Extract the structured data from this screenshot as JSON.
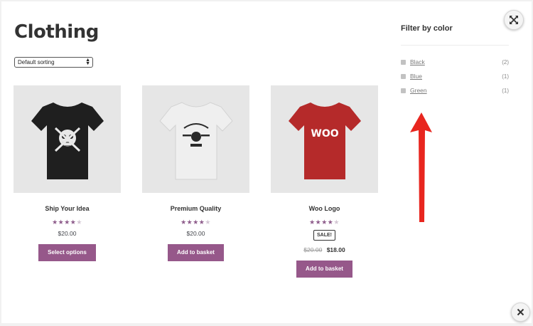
{
  "page": {
    "title": "Clothing"
  },
  "sorting": {
    "selected": "Default sorting"
  },
  "products": [
    {
      "name": "Ship Your Idea",
      "rating": 4.5,
      "price": "$20.00",
      "button": "Select options",
      "shirt_color": "#1f1f1f"
    },
    {
      "name": "Premium Quality",
      "rating": 4.5,
      "price": "$20.00",
      "button": "Add to basket",
      "shirt_color": "#efefef"
    },
    {
      "name": "Woo Logo",
      "rating": 4,
      "sale_badge": "SALE!",
      "old_price": "$20.00",
      "price": "$18.00",
      "button": "Add to basket",
      "shirt_color": "#b52a2a",
      "shirt_text": "WOO"
    }
  ],
  "sidebar": {
    "title": "Filter by color",
    "items": [
      {
        "label": "Black",
        "count": "(2)"
      },
      {
        "label": "Blue",
        "count": "(1)"
      },
      {
        "label": "Green",
        "count": "(1)"
      }
    ]
  },
  "colors": {
    "accent": "#96588a",
    "star": "#8e5c8b",
    "arrow": "#e8261f"
  },
  "icons": {
    "top_right": "expand-icon",
    "bottom_right": "close-icon"
  }
}
